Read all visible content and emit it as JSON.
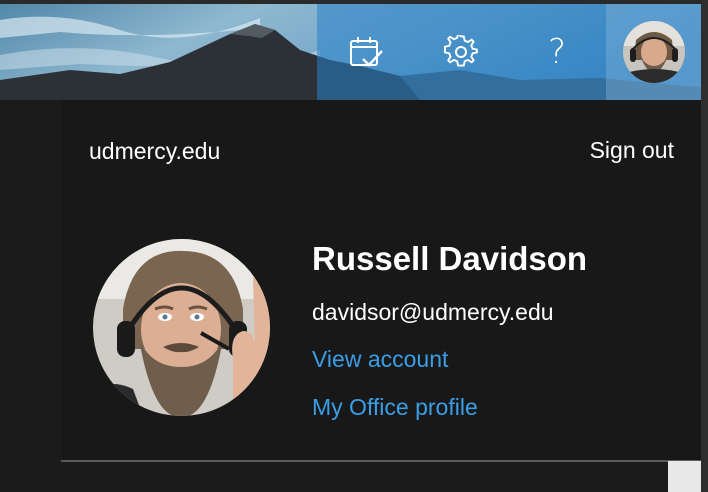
{
  "header": {
    "icons": {
      "calendar": "calendar-check-icon",
      "settings": "gear-icon",
      "help": "question-mark-icon"
    },
    "help_glyph": "?"
  },
  "account": {
    "org": "udmercy.edu",
    "sign_out": "Sign out",
    "name": "Russell Davidson",
    "email": "davidsor@udmercy.edu",
    "view_account": "View account",
    "office_profile": "My Office profile"
  },
  "colors": {
    "panel_bg": "#181818",
    "link": "#3a9ee6",
    "toolbar_tint": "#2882c8"
  }
}
